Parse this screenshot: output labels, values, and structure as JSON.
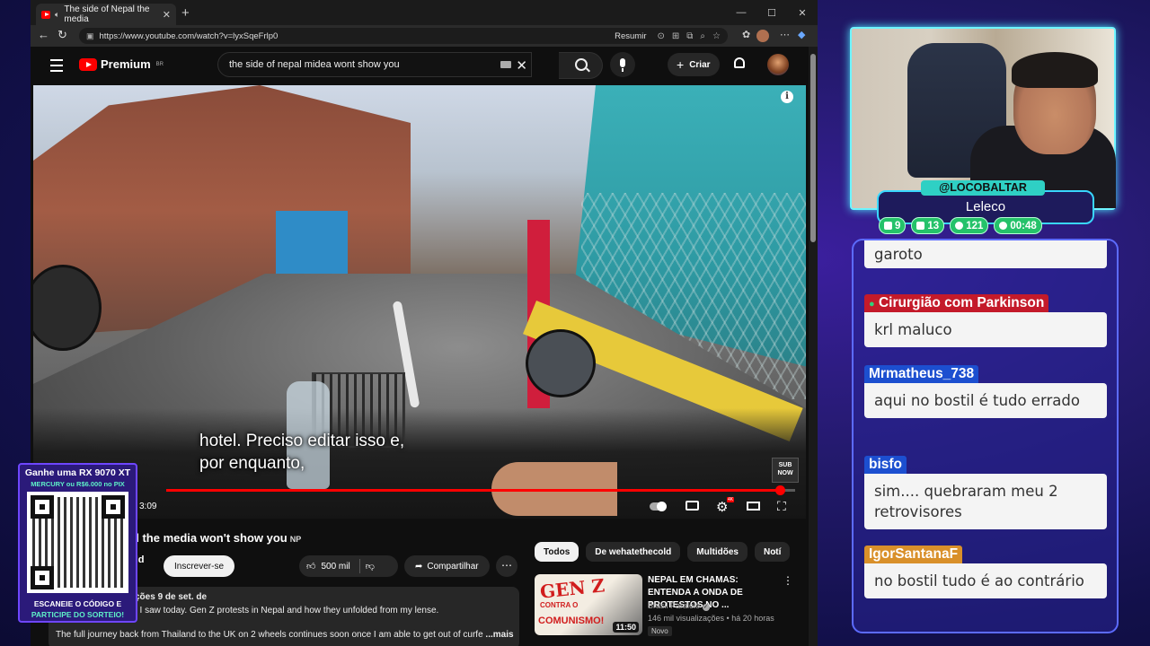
{
  "browser": {
    "tab_title": "The side of Nepal the media",
    "url": "https://www.youtube.com/watch?v=lyxSqeFrlp0",
    "resumir_label": "Resumir"
  },
  "youtube": {
    "logo_text": "Premium",
    "logo_region": "BR",
    "search_query": "the side of nepal midea wont show you",
    "create_label": "Criar",
    "caption_line1": "hotel.  Preciso editar isso e,",
    "caption_line2": "por enquanto,",
    "subnow_line1": "SUB",
    "subnow_line2": "NOW",
    "timecode": "3:09",
    "progress_fraction": 0.975,
    "video_title": "al the media won't show you",
    "video_title_badge": "NP",
    "channel_fragment": "old",
    "subscribe_label": "Inscrever-se",
    "like_count": "500 mil",
    "share_label": "Compartilhar",
    "desc_meta": "ções  9 de set. de",
    "desc_line1": "t I saw today. Gen Z protests in Nepal and how they unfolded from my lense.",
    "desc_line2": "The full journey back from Thailand to the UK on 2 wheels continues soon once I am able to get out of curfe",
    "desc_more": " ...mais",
    "chips": [
      "Todos",
      "De wehatethecold",
      "Multidões",
      "Notí"
    ],
    "rec": {
      "thumb_line1": "GEN Z",
      "thumb_line2": "CONTRA O",
      "thumb_line3": "COMUNISMO!",
      "duration": "11:50",
      "title": "NEPAL EM CHAMAS: ENTENDA A ONDA DE PROTESTOS NO ...",
      "channel": "Brasil Paralelo",
      "meta": "146 mil visualizações • há 20 horas",
      "badge": "Novo"
    }
  },
  "promo": {
    "line1": "Ganhe uma RX 9070 XT",
    "line2": "MERCURY ou R$6.000 no PIX",
    "line3": "ESCANEIE O CÓDIGO E",
    "line4": "PARTICIPE DO SORTEIO!"
  },
  "overlay": {
    "handle": "@LOCOBALTAR",
    "streamer_name": "Leleco",
    "stats": [
      "9",
      "13",
      "121",
      "00:48"
    ]
  },
  "chat": [
    {
      "user": "",
      "text": "garoto",
      "user_color": "#c0392b"
    },
    {
      "user": "Cirurgião com Parkinson",
      "text": "krl maluco",
      "user_color": "#c41a2a"
    },
    {
      "user": "Mrmatheus_738",
      "text": "aqui no bostil é tudo errado",
      "user_color": "#1c4fd0"
    },
    {
      "user": "bisfo",
      "text": "sim.... quebraram meu 2 retrovisores",
      "user_color": "#1c4fd0"
    },
    {
      "user": "IgorSantanaF",
      "text": "no bostil tudo é ao contrário",
      "user_color": "#d9902a"
    }
  ]
}
